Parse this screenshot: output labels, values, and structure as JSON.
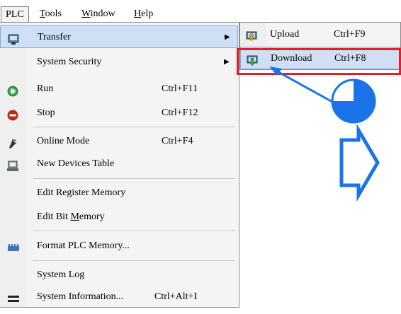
{
  "menubar": {
    "items": [
      {
        "label": "PLC",
        "underline": ""
      },
      {
        "pre": "",
        "u": "T",
        "post": "ools"
      },
      {
        "pre": "",
        "u": "W",
        "post": "indow"
      },
      {
        "pre": "",
        "u": "H",
        "post": "elp"
      }
    ]
  },
  "plc_menu": {
    "items": [
      {
        "label": "Transfer",
        "shortcut": "",
        "icon": "transfer-icon",
        "submenu": true
      },
      {
        "label": "System Security",
        "shortcut": "",
        "icon": "",
        "submenu": true
      },
      {
        "label": "Run",
        "shortcut": "Ctrl+F11",
        "icon": "run-icon"
      },
      {
        "label": "Stop",
        "shortcut": "Ctrl+F12",
        "icon": "stop-icon"
      },
      {
        "label": "Online Mode",
        "shortcut": "Ctrl+F4",
        "icon": "online-mode-icon"
      },
      {
        "label": "New Devices Table",
        "shortcut": "",
        "icon": "devices-icon"
      },
      {
        "label": "Edit Register Memory",
        "shortcut": "",
        "icon": ""
      },
      {
        "label_pre": "Edit Bit ",
        "label_u": "M",
        "label_post": "emory",
        "shortcut": "",
        "icon": ""
      },
      {
        "label": "Format PLC Memory...",
        "shortcut": "",
        "icon": "format-memory-icon"
      },
      {
        "label": "System Log",
        "shortcut": "",
        "icon": ""
      },
      {
        "label": "System Information...",
        "shortcut": "Ctrl+Alt+I",
        "icon": "system-info-icon"
      }
    ]
  },
  "transfer_submenu": {
    "items": [
      {
        "label": "Upload",
        "shortcut": "Ctrl+F9",
        "icon": "upload-icon"
      },
      {
        "label": "Download",
        "shortcut": "Ctrl+F8",
        "icon": "download-icon"
      }
    ]
  },
  "colors": {
    "highlight": "#cfe0f5",
    "highlight_border": "#86a9d8",
    "annotation_red": "#e0202a",
    "annotation_blue": "#1a73e8"
  }
}
